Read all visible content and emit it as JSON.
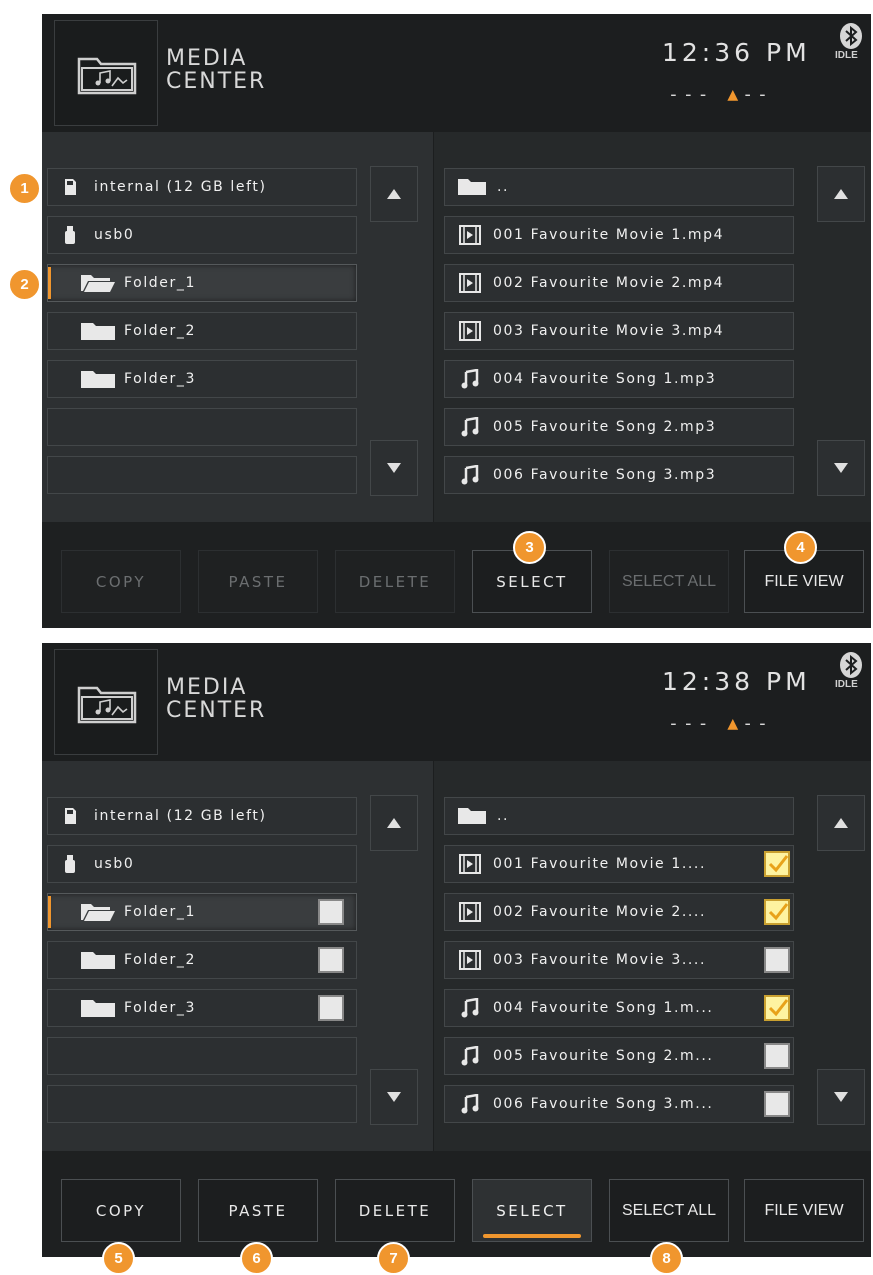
{
  "app": {
    "title_line1": "MEDIA",
    "title_line2": "CENTER",
    "bt_status": "IDLE",
    "signal_left": "---",
    "signal_right": "--"
  },
  "colors": {
    "accent": "#f0962e",
    "background": "#252829",
    "header": "#1c1e1f"
  },
  "screen1": {
    "time": "12:36 PM",
    "left_items": [
      {
        "label": "internal (12 GB left)",
        "icon": "sd-card-icon"
      },
      {
        "label": "usb0",
        "icon": "usb-icon"
      },
      {
        "label": "Folder_1",
        "icon": "open-folder-icon",
        "selected": true
      },
      {
        "label": "Folder_2",
        "icon": "folder-icon"
      },
      {
        "label": "Folder_3",
        "icon": "folder-icon"
      }
    ],
    "right_items": [
      {
        "label": "..",
        "icon": "folder-icon"
      },
      {
        "label": "001 Favourite Movie 1.mp4",
        "icon": "video-icon"
      },
      {
        "label": "002 Favourite Movie 2.mp4",
        "icon": "video-icon"
      },
      {
        "label": "003 Favourite Movie 3.mp4",
        "icon": "video-icon"
      },
      {
        "label": "004 Favourite Song 1.mp3",
        "icon": "music-icon"
      },
      {
        "label": "005 Favourite Song 2.mp3",
        "icon": "music-icon"
      },
      {
        "label": "006 Favourite Song 3.mp3",
        "icon": "music-icon"
      }
    ],
    "buttons": [
      "COPY",
      "PASTE",
      "DELETE",
      "SELECT",
      "SELECT ALL",
      "FILE VIEW"
    ]
  },
  "screen2": {
    "time": "12:38 PM",
    "left_items": [
      {
        "label": "internal (12 GB left)",
        "icon": "sd-card-icon"
      },
      {
        "label": "usb0",
        "icon": "usb-icon"
      },
      {
        "label": "Folder_1",
        "icon": "open-folder-icon",
        "selected": true,
        "checked": false
      },
      {
        "label": "Folder_2",
        "icon": "folder-icon",
        "checked": false
      },
      {
        "label": "Folder_3",
        "icon": "folder-icon",
        "checked": false
      }
    ],
    "right_items": [
      {
        "label": "..",
        "icon": "folder-icon"
      },
      {
        "label": "001 Favourite Movie 1....",
        "icon": "video-icon",
        "checked": true
      },
      {
        "label": "002 Favourite Movie 2....",
        "icon": "video-icon",
        "checked": true
      },
      {
        "label": "003 Favourite Movie 3....",
        "icon": "video-icon",
        "checked": false
      },
      {
        "label": "004 Favourite Song 1.m...",
        "icon": "music-icon",
        "checked": true
      },
      {
        "label": "005 Favourite Song 2.m...",
        "icon": "music-icon",
        "checked": false
      },
      {
        "label": "006 Favourite Song 3.m...",
        "icon": "music-icon",
        "checked": false
      }
    ],
    "buttons": [
      "COPY",
      "PASTE",
      "DELETE",
      "SELECT",
      "SELECT ALL",
      "FILE VIEW"
    ]
  },
  "callouts": [
    "1",
    "2",
    "3",
    "4",
    "5",
    "6",
    "7",
    "8"
  ]
}
